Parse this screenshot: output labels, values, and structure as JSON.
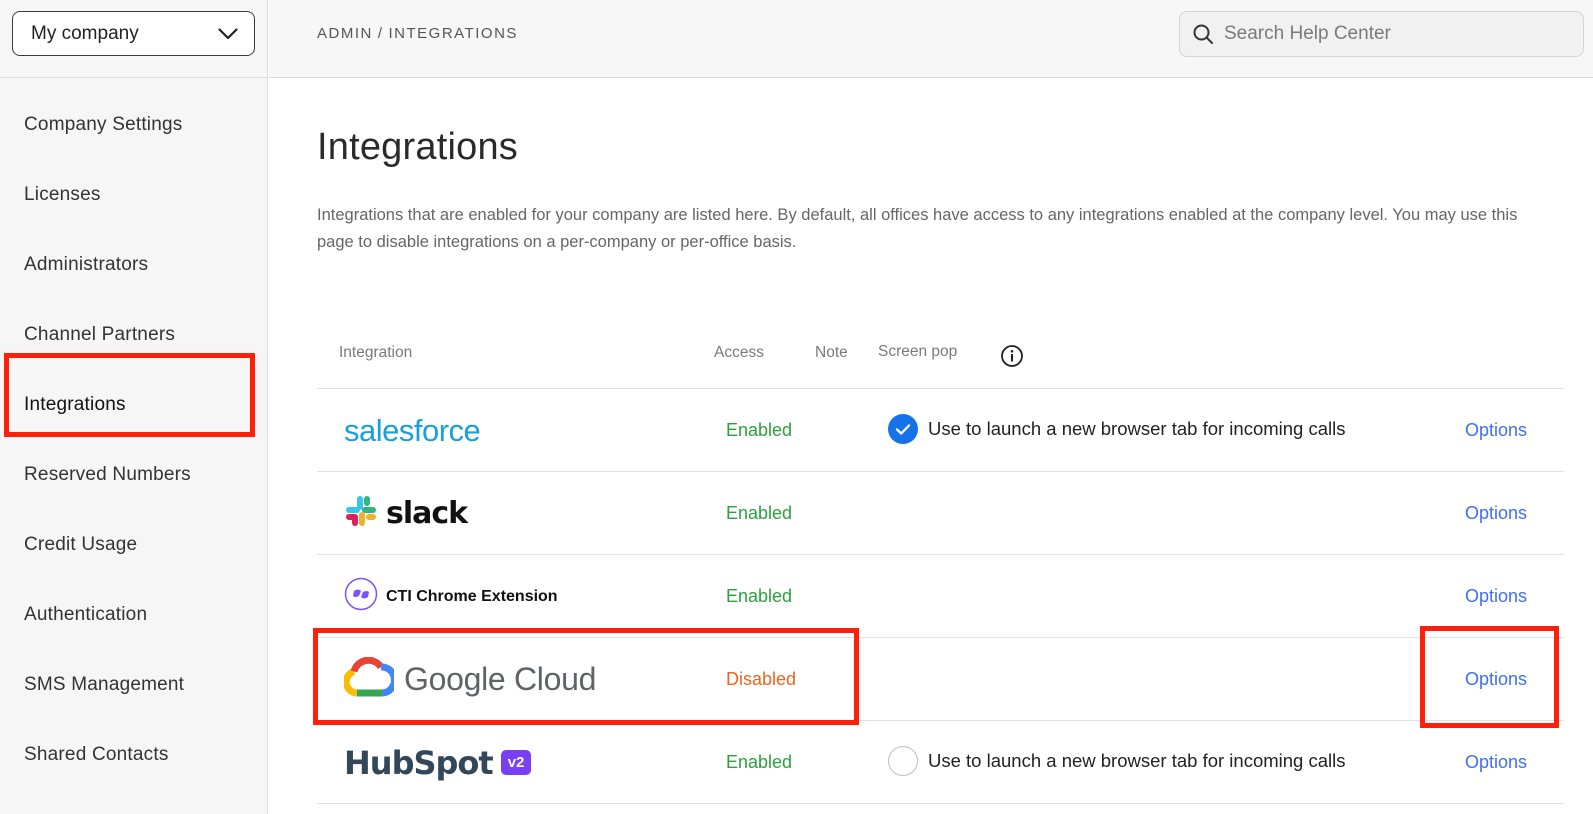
{
  "sidebar": {
    "company_selector": "My company",
    "items": [
      {
        "label": "Company Settings"
      },
      {
        "label": "Licenses"
      },
      {
        "label": "Administrators"
      },
      {
        "label": "Channel Partners"
      },
      {
        "label": "Integrations",
        "active": true
      },
      {
        "label": "Reserved Numbers"
      },
      {
        "label": "Credit Usage"
      },
      {
        "label": "Authentication"
      },
      {
        "label": "SMS Management"
      },
      {
        "label": "Shared Contacts"
      }
    ]
  },
  "header": {
    "breadcrumb": [
      "ADMIN",
      "INTEGRATIONS"
    ],
    "breadcrumb_separator": "/",
    "search_placeholder": "Search Help Center"
  },
  "main": {
    "title": "Integrations",
    "description": "Integrations that are enabled for your company are listed here. By default, all offices have access to any integrations enabled at the company level. You may use this page to disable integrations on a per-company or per-office basis.",
    "table": {
      "columns": {
        "integration": "Integration",
        "access": "Access",
        "note": "Note",
        "screen_pop": "Screen pop"
      },
      "rows": [
        {
          "name": "salesforce",
          "access": "Enabled",
          "screen_pop": "Use to launch a new browser tab for incoming calls",
          "screen_pop_checked": true,
          "options": "Options"
        },
        {
          "name": "slack",
          "access": "Enabled",
          "options": "Options"
        },
        {
          "name": "CTI Chrome Extension",
          "access": "Enabled",
          "options": "Options"
        },
        {
          "name": "Google Cloud",
          "access": "Disabled",
          "options": "Options"
        },
        {
          "name": "HubSpot",
          "badge": "v2",
          "access": "Enabled",
          "screen_pop": "Use to launch a new browser tab for incoming calls",
          "screen_pop_checked": false,
          "options": "Options"
        }
      ]
    }
  },
  "colors": {
    "enabled": "#2aa13b",
    "disabled": "#f0621f",
    "link": "#3d6ef5",
    "highlight": "#ff1f0b"
  }
}
